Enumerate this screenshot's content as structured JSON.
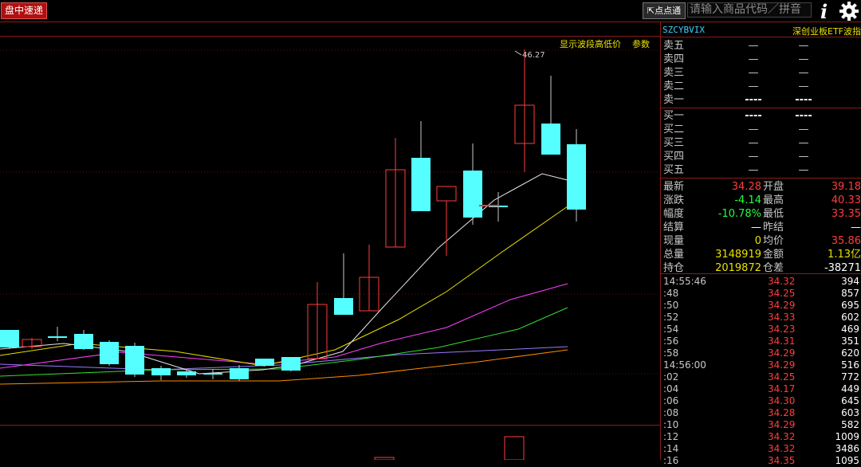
{
  "topbar": {
    "app_tag": "盘中速递",
    "dian_label": "点点通",
    "search_placeholder": "请输入商品代码／拼音"
  },
  "chart": {
    "note_primary": "显示波段高低价",
    "note_params": "参数",
    "high_label": "46.27"
  },
  "panel": {
    "code": "SZCYBVIX",
    "name": "深创业板ETF波指",
    "asks": [
      {
        "label": "卖五",
        "price": "—",
        "vol": "—"
      },
      {
        "label": "卖四",
        "price": "—",
        "vol": "—"
      },
      {
        "label": "卖三",
        "price": "—",
        "vol": "—"
      },
      {
        "label": "卖二",
        "price": "—",
        "vol": "—"
      },
      {
        "label": "卖一",
        "price": "----",
        "vol": "----"
      }
    ],
    "bids": [
      {
        "label": "买一",
        "price": "----",
        "vol": "----"
      },
      {
        "label": "买二",
        "price": "—",
        "vol": "—"
      },
      {
        "label": "买三",
        "price": "—",
        "vol": "—"
      },
      {
        "label": "买四",
        "price": "—",
        "vol": "—"
      },
      {
        "label": "买五",
        "price": "—",
        "vol": "—"
      }
    ],
    "quote": [
      {
        "l1": "最新",
        "v1": "34.28",
        "c1": "red",
        "l2": "开盘",
        "v2": "39.18",
        "c2": "red"
      },
      {
        "l1": "涨跌",
        "v1": "-4.14",
        "c1": "green",
        "l2": "最高",
        "v2": "40.33",
        "c2": "red"
      },
      {
        "l1": "幅度",
        "v1": "-10.78%",
        "c1": "green",
        "l2": "最低",
        "v2": "33.35",
        "c2": "red"
      },
      {
        "l1": "结算",
        "v1": "—",
        "c1": "white",
        "l2": "昨结",
        "v2": "—",
        "c2": "white"
      },
      {
        "l1": "现量",
        "v1": "0",
        "c1": "yellow",
        "l2": "均价",
        "v2": "35.86",
        "c2": "red"
      },
      {
        "l1": "总量",
        "v1": "3148919",
        "c1": "yellow",
        "l2": "金额",
        "v2": "1.13亿",
        "c2": "yellow"
      },
      {
        "l1": "持仓",
        "v1": "2019872",
        "c1": "yellow",
        "l2": "仓差",
        "v2": "-38271",
        "c2": "white"
      }
    ],
    "ticks": [
      {
        "time": "14:55:46",
        "price": "34.32",
        "vol": "394"
      },
      {
        "time": ":48",
        "price": "34.25",
        "vol": "857"
      },
      {
        "time": ":50",
        "price": "34.29",
        "vol": "695"
      },
      {
        "time": ":52",
        "price": "34.33",
        "vol": "602"
      },
      {
        "time": ":54",
        "price": "34.23",
        "vol": "469"
      },
      {
        "time": ":56",
        "price": "34.31",
        "vol": "351"
      },
      {
        "time": ":58",
        "price": "34.29",
        "vol": "620"
      },
      {
        "time": "14:56:00",
        "price": "34.29",
        "vol": "516"
      },
      {
        "time": ":02",
        "price": "34.25",
        "vol": "772"
      },
      {
        "time": ":04",
        "price": "34.17",
        "vol": "449"
      },
      {
        "time": ":06",
        "price": "34.30",
        "vol": "645"
      },
      {
        "time": ":08",
        "price": "34.28",
        "vol": "603"
      },
      {
        "time": ":10",
        "price": "34.29",
        "vol": "582"
      },
      {
        "time": ":12",
        "price": "34.32",
        "vol": "1009"
      },
      {
        "time": ":14",
        "price": "34.32",
        "vol": "3486"
      },
      {
        "time": ":16",
        "price": "34.35",
        "vol": "1095"
      }
    ]
  },
  "colors": {
    "up": "#ff3c3c",
    "down": "#55ffff",
    "ma5": "#e6e6e6",
    "ma10": "#e8e000",
    "ma20": "#ff40ff",
    "ma30": "#30e030",
    "ma60": "#9a78ff",
    "ma120": "#ff8a00"
  }
}
